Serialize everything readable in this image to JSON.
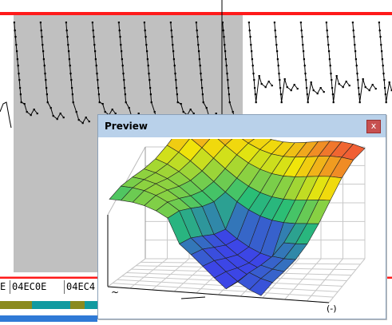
{
  "hex_strip": [
    "E",
    "04EC0E",
    "04EC4"
  ],
  "preview": {
    "title": "Preview",
    "close_glyph": "x",
    "axis_label_left": "~",
    "axis_label_right": "(-)"
  },
  "colors": {
    "red_line": "#ff1a1a",
    "gray_region": "#c0c0c0",
    "title_bar": "#b9d1ea",
    "close_button": "#c75050",
    "track_olive": "#8a8a1e",
    "track_teal": "#119aa0",
    "track_blue": "#2f7ad6"
  },
  "icons": [
    "close-icon"
  ]
}
